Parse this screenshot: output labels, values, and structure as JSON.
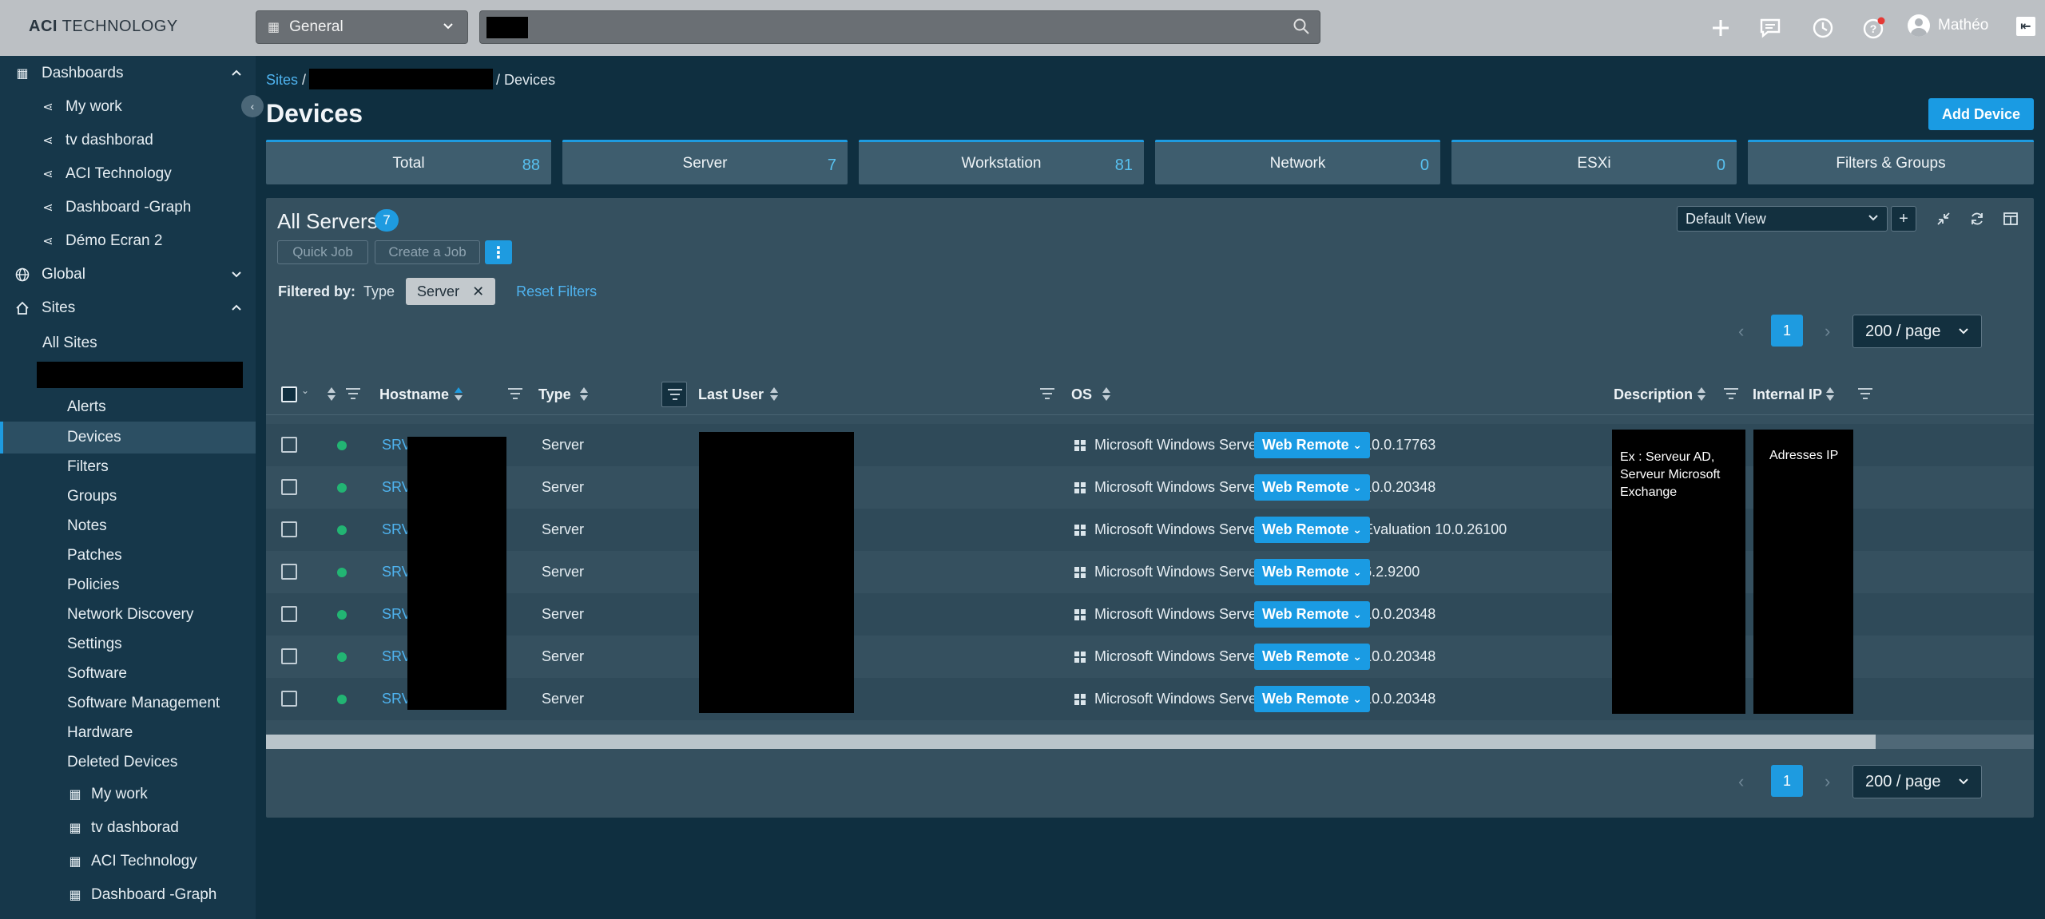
{
  "topbar": {
    "logo_bold": "ACI",
    "logo_rest": " TECHNOLOGY",
    "workspace": "General",
    "user_name": "Mathéo"
  },
  "sidebar": {
    "dashboards": "Dashboards",
    "dash_items": [
      "My work",
      "tv dashborad",
      "ACI Technology",
      "Dashboard -Graph",
      "Démo Ecran 2"
    ],
    "global": "Global",
    "sites": "Sites",
    "all_sites": "All Sites",
    "site_items": [
      "Alerts",
      "Devices",
      "Filters",
      "Groups",
      "Notes",
      "Patches",
      "Policies",
      "Network Discovery",
      "Settings",
      "Software",
      "Software Management",
      "Hardware",
      "Deleted Devices"
    ],
    "sub_dash_items": [
      "My work",
      "tv dashborad",
      "ACI Technology",
      "Dashboard -Graph"
    ]
  },
  "breadcrumb": {
    "root": "Sites",
    "sep1": " /",
    "sep2": "/ Devices"
  },
  "page": {
    "title": "Devices",
    "add_button": "Add Device"
  },
  "cards": [
    {
      "name": "Total",
      "count": "88"
    },
    {
      "name": "Server",
      "count": "7"
    },
    {
      "name": "Workstation",
      "count": "81"
    },
    {
      "name": "Network",
      "count": "0"
    },
    {
      "name": "ESXi",
      "count": "0"
    },
    {
      "name": "Filters & Groups",
      "count": ""
    }
  ],
  "panel": {
    "title": "All Servers",
    "count": "7",
    "quick_job": "Quick Job",
    "create_job": "Create a Job",
    "more": "⋮",
    "filtered_by": "Filtered by:",
    "filter_type": "Type",
    "filter_tag": "Server",
    "reset": "Reset Filters",
    "view": "Default View"
  },
  "pager": {
    "page": "1",
    "size": "200 / page"
  },
  "columns": {
    "hostname": "Hostname",
    "type": "Type",
    "last_user": "Last User",
    "os": "OS",
    "description": "Description",
    "internal_ip": "Internal IP"
  },
  "rows": [
    {
      "host": "SRV",
      "type": "Server",
      "os": "Microsoft Windows Server 2019 Standard 10.0.17763"
    },
    {
      "host": "SRV",
      "type": "Server",
      "os": "Microsoft Windows Server 2022 Standard 10.0.20348"
    },
    {
      "host": "SRV",
      "type": "Server",
      "os": "Microsoft Windows Server 2025 Standard Evaluation 10.0.26100"
    },
    {
      "host": "SRV",
      "type": "Server",
      "os": "Microsoft Windows Server 2012 Standard 6.2.9200"
    },
    {
      "host": "SRV",
      "type": "Server",
      "os": "Microsoft Windows Server 2022 Standard 10.0.20348"
    },
    {
      "host": "SRV",
      "type": "Server",
      "os": "Microsoft Windows Server 2022 Standard 10.0.20348"
    },
    {
      "host": "SRV",
      "type": "Server",
      "os": "Microsoft Windows Server 2022 Standard 10.0.20348"
    }
  ],
  "description_note": "Ex : Serveur AD, Serveur Microsoft Exchange",
  "ip_note": "Adresses  IP",
  "web_remote": "Web Remote",
  "colors": {
    "accent": "#1e9be0",
    "online": "#22b573",
    "background": "#0f2f40"
  }
}
